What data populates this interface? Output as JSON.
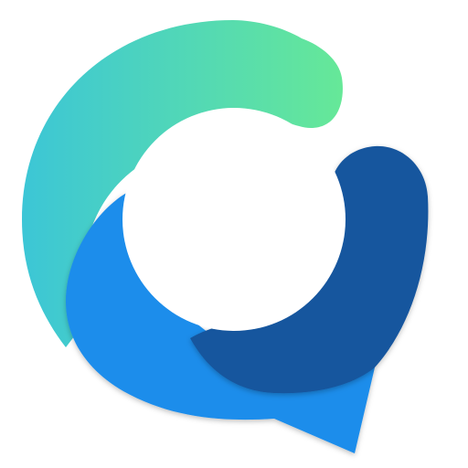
{
  "logo": {
    "name": "app-logo",
    "colors": {
      "gradient_start": "#3CC6D6",
      "gradient_end": "#66E898",
      "mid_blue": "#1E8DEB",
      "dark_blue": "#17569E",
      "background": "#FFFFFF"
    }
  }
}
